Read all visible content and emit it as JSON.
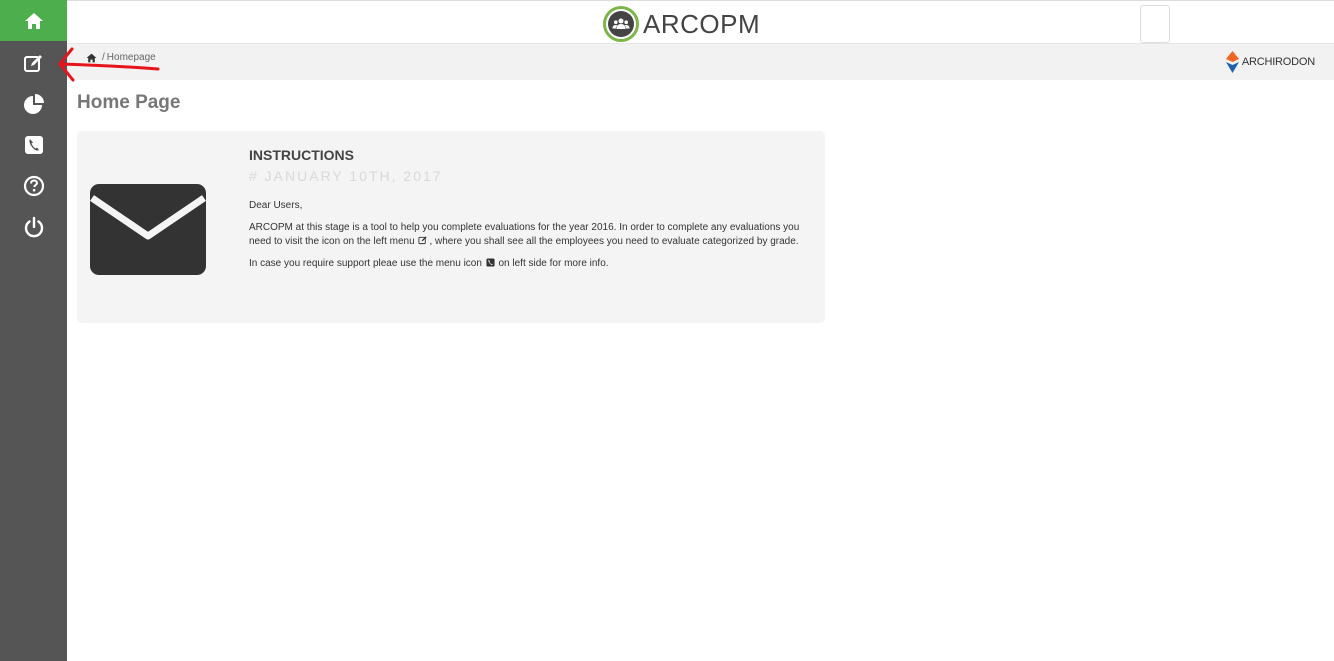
{
  "app": {
    "name": "ARCOPM"
  },
  "sidebar": {
    "items": [
      {
        "name": "home",
        "icon": "home-icon"
      },
      {
        "name": "evaluations",
        "icon": "edit-icon"
      },
      {
        "name": "reports",
        "icon": "pie-chart-icon"
      },
      {
        "name": "support",
        "icon": "phone-icon"
      },
      {
        "name": "help",
        "icon": "question-icon"
      },
      {
        "name": "logout",
        "icon": "power-icon"
      }
    ]
  },
  "breadcrumb": {
    "home_icon": "home-icon",
    "separator": "/",
    "current": "Homepage"
  },
  "partner": {
    "label": "ARCHIRODON"
  },
  "main": {
    "title": "Home Page",
    "card": {
      "title": "INSTRUCTIONS",
      "date": "# JANUARY 10TH, 2017",
      "greeting": "Dear Users,",
      "para1_a": "ARCOPM at this stage is a tool to help you complete evaluations for the year 2016. In order to complete any evaluations you need to visit the icon on the left menu",
      "para1_b": ", where you shall see all the employees you need to evaluate categorized by grade.",
      "para2_a": "In case you require support pleae use the menu icon",
      "para2_b": "on left side for more info."
    }
  },
  "colors": {
    "sidebar": "#555555",
    "active": "#4cae4c",
    "annotation": "#e8141b",
    "partner_orange": "#f26522",
    "partner_blue": "#1f5fae"
  }
}
